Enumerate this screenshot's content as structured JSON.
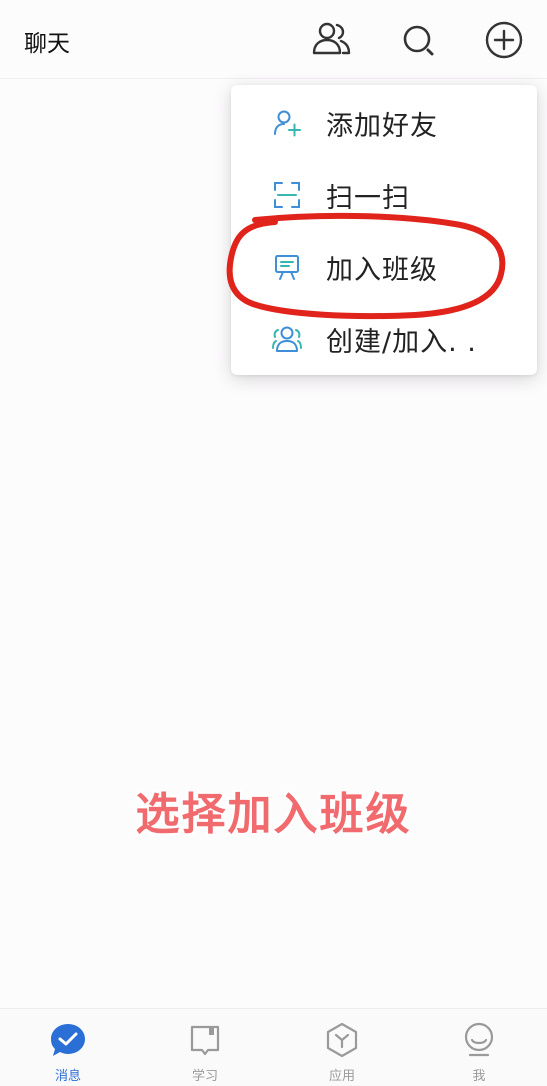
{
  "header": {
    "title": "聊天",
    "icons": [
      "contacts-icon",
      "search-icon",
      "add-icon"
    ]
  },
  "menu": {
    "items": [
      {
        "label": "添加好友",
        "icon": "add-friend-icon"
      },
      {
        "label": "扫一扫",
        "icon": "scan-icon"
      },
      {
        "label": "加入班级",
        "icon": "class-board-icon"
      },
      {
        "label": "创建/加入. .",
        "icon": "group-icon"
      }
    ]
  },
  "annotation": {
    "caption": "选择加入班级",
    "circle_color": "#e0241b",
    "caption_color": "#f06a6e"
  },
  "bottom_nav": {
    "items": [
      {
        "label": "消息",
        "icon": "message-icon",
        "active": true
      },
      {
        "label": "学习",
        "icon": "study-book-icon",
        "active": false
      },
      {
        "label": "应用",
        "icon": "apps-hexagon-icon",
        "active": false
      },
      {
        "label": "我",
        "icon": "profile-icon",
        "active": false
      }
    ]
  },
  "colors": {
    "accent": "#2a6fd6",
    "menu_icon": "#3f8fd8",
    "inactive": "#9a9a9a"
  }
}
